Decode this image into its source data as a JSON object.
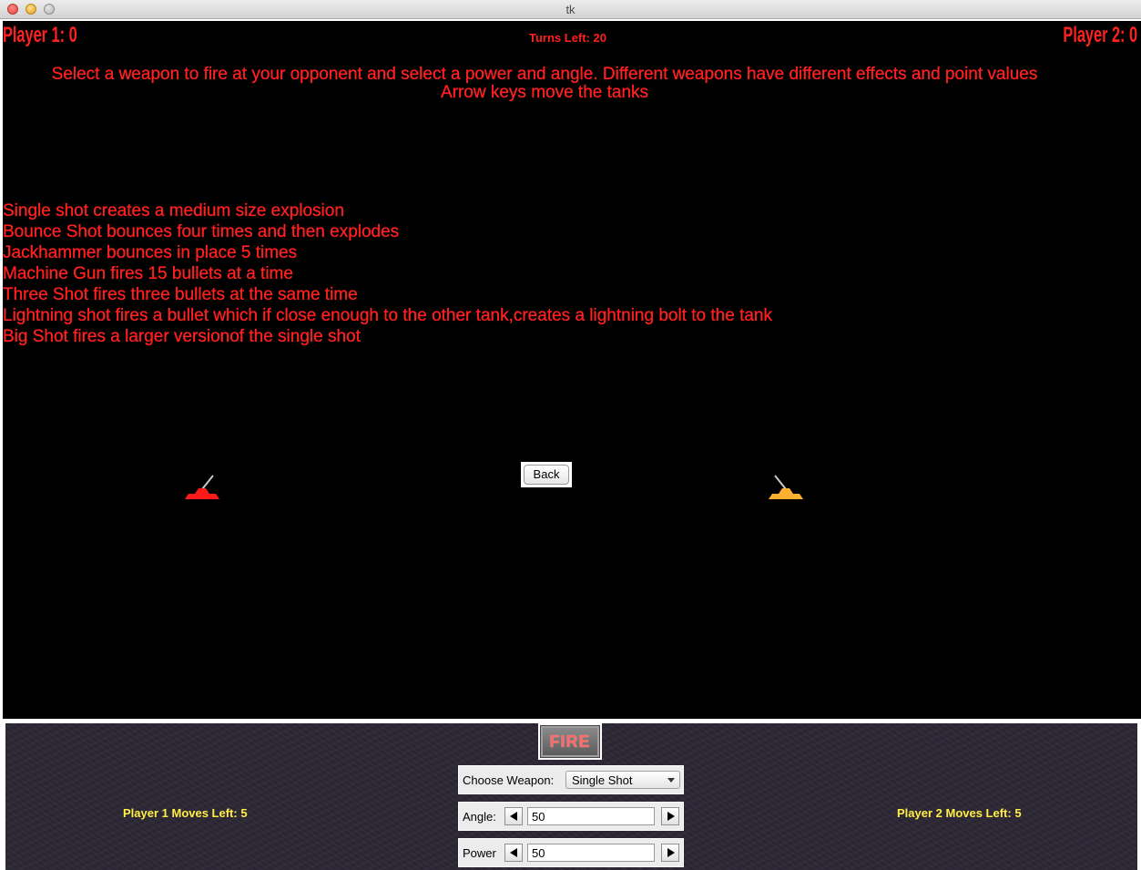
{
  "window": {
    "title": "tk"
  },
  "game": {
    "player1_score": "Player 1: 0",
    "player2_score": "Player 2: 0",
    "turns_left": "Turns Left: 20",
    "instructions_line1": "Select a weapon to fire at your opponent and select a power and angle.  Different weapons have different effects and point values",
    "instructions_line2": "Arrow keys move the tanks",
    "weapon_descriptions": [
      "Single shot creates a medium size explosion",
      "Bounce Shot bounces four times and then explodes",
      "Jackhammer bounces in place 5 times",
      "Machine Gun fires 15 bullets at a time",
      "Three Shot fires three bullets at the same time",
      "Lightning shot fires a bullet which if close enough to the other tank,creates a lightning bolt to the tank",
      "Big Shot fires a larger versionof the single shot"
    ],
    "back_label": "Back",
    "tank_colors": {
      "player1": "#ff1a1a",
      "player2": "#ffb030",
      "barrel": "#c8c8c8"
    },
    "text_color": "#ff2020",
    "background": "#000000"
  },
  "controls": {
    "fire_label": "FIRE",
    "weapon_label": "Choose Weapon:",
    "weapon_selected": "Single Shot",
    "angle_label": "Angle:",
    "angle_value": "50",
    "power_label": "Power",
    "power_value": "50",
    "player1_moves": "Player 1 Moves Left: 5",
    "player2_moves": "Player 2 Moves Left: 5",
    "moves_color": "#ffee44"
  }
}
